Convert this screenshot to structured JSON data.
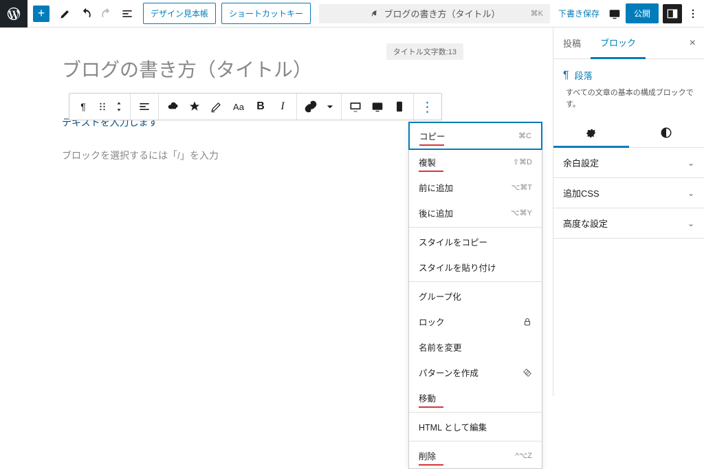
{
  "top": {
    "design_sample": "デザイン見本帳",
    "shortcut_key": "ショートカットキー",
    "doc_title": "ブログの書き方（タイトル）",
    "doc_kbd": "⌘K",
    "save_draft": "下書き保存",
    "publish": "公開"
  },
  "editor": {
    "title_count": "タイトル文字数:13",
    "post_title": "ブログの書き方（タイトル）",
    "text_line": "テキストを入力します",
    "placeholder": "ブロックを選択するには「/」を入力"
  },
  "menu": {
    "copy": {
      "label": "コピー",
      "sc": "⌘C",
      "ul": true
    },
    "dup": {
      "label": "複製",
      "sc": "⇧⌘D",
      "ul": true
    },
    "before": {
      "label": "前に追加",
      "sc": "⌥⌘T"
    },
    "after": {
      "label": "後に追加",
      "sc": "⌥⌘Y"
    },
    "copy_style": {
      "label": "スタイルをコピー"
    },
    "paste_style": {
      "label": "スタイルを貼り付け"
    },
    "group": {
      "label": "グループ化"
    },
    "lock": {
      "label": "ロック",
      "icon": "lock"
    },
    "rename": {
      "label": "名前を変更"
    },
    "pattern": {
      "label": "パターンを作成",
      "icon": "pattern"
    },
    "move": {
      "label": "移動",
      "ul": true
    },
    "html": {
      "label": "HTML として編集"
    },
    "delete": {
      "label": "削除",
      "sc": "^⌥Z",
      "ul": true
    }
  },
  "sidebar": {
    "tab_post": "投稿",
    "tab_block": "ブロック",
    "block_name": "段落",
    "block_desc": "すべての文章の基本の構成ブロックです。",
    "panel_margin": "余白設定",
    "panel_css": "追加CSS",
    "panel_adv": "高度な設定"
  }
}
